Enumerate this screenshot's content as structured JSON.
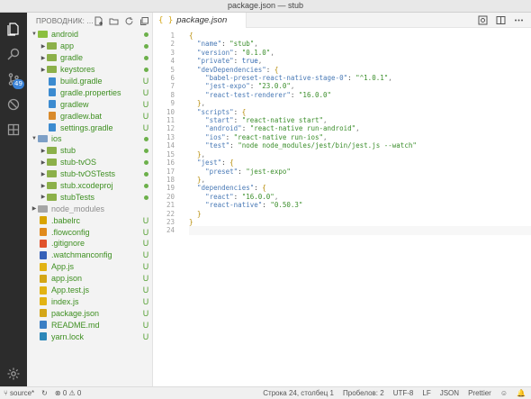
{
  "window": {
    "title": "package.json — stub"
  },
  "explorer": {
    "title": "ПРОВОДНИК: ...",
    "badge": "49",
    "items": [
      {
        "label": "android",
        "kind": "folder-open",
        "status": "dot"
      },
      {
        "label": "app",
        "kind": "folder",
        "status": "dot"
      },
      {
        "label": "gradle",
        "kind": "folder",
        "status": "dot"
      },
      {
        "label": "keystores",
        "kind": "folder",
        "status": "dot"
      },
      {
        "label": "build.gradle",
        "kind": "gradle",
        "status": "U"
      },
      {
        "label": "gradle.properties",
        "kind": "gradle",
        "status": "U"
      },
      {
        "label": "gradlew",
        "kind": "gradle",
        "status": "U"
      },
      {
        "label": "gradlew.bat",
        "kind": "bat",
        "status": "U"
      },
      {
        "label": "settings.gradle",
        "kind": "gradle",
        "status": "U"
      },
      {
        "label": "ios",
        "kind": "folder-open-ios",
        "status": "dot"
      },
      {
        "label": "stub",
        "kind": "folder",
        "status": "dot"
      },
      {
        "label": "stub-tvOS",
        "kind": "folder",
        "status": "dot"
      },
      {
        "label": "stub-tvOSTests",
        "kind": "folder",
        "status": "dot"
      },
      {
        "label": "stub.xcodeproj",
        "kind": "folder",
        "status": "dot"
      },
      {
        "label": "stubTests",
        "kind": "folder",
        "status": "dot"
      },
      {
        "label": "node_modules",
        "kind": "folder-grey",
        "status": ""
      },
      {
        "label": ".babelrc",
        "kind": "babel",
        "status": "U"
      },
      {
        "label": ".flowconfig",
        "kind": "flow",
        "status": "U"
      },
      {
        "label": ".gitignore",
        "kind": "git",
        "status": "U"
      },
      {
        "label": ".watchmanconfig",
        "kind": "watchman",
        "status": "U"
      },
      {
        "label": "App.js",
        "kind": "js",
        "status": "U"
      },
      {
        "label": "app.json",
        "kind": "json",
        "status": "U"
      },
      {
        "label": "App.test.js",
        "kind": "js",
        "status": "U"
      },
      {
        "label": "index.js",
        "kind": "js",
        "status": "U"
      },
      {
        "label": "package.json",
        "kind": "json",
        "status": "U"
      },
      {
        "label": "README.md",
        "kind": "md",
        "status": "U"
      },
      {
        "label": "yarn.lock",
        "kind": "yarn",
        "status": "U"
      }
    ]
  },
  "tab": {
    "label": "package.json",
    "icon": "{ }"
  },
  "editor": {
    "lines": [
      "{",
      "  \"name\": \"stub\",",
      "  \"version\": \"0.1.0\",",
      "  \"private\": true,",
      "  \"devDependencies\": {",
      "    \"babel-preset-react-native-stage-0\": \"^1.0.1\",",
      "    \"jest-expo\": \"23.0.0\",",
      "    \"react-test-renderer\": \"16.0.0\"",
      "  },",
      "  \"scripts\": {",
      "    \"start\": \"react-native start\",",
      "    \"android\": \"react-native run-android\",",
      "    \"ios\": \"react-native run-ios\",",
      "    \"test\": \"node node_modules/jest/bin/jest.js --watch\"",
      "  },",
      "  \"jest\": {",
      "    \"preset\": \"jest-expo\"",
      "  },",
      "  \"dependencies\": {",
      "    \"react\": \"16.0.0\",",
      "    \"react-native\": \"0.50.3\"",
      "  }",
      "}",
      ""
    ],
    "current_line": 24
  },
  "status": {
    "branch": "source*",
    "sync": "↻",
    "errors": "0",
    "warnings": "0",
    "position": "Строка 24, столбец 1",
    "spaces": "Пробелов: 2",
    "encoding": "UTF-8",
    "eol": "LF",
    "language": "JSON",
    "formatter": "Prettier"
  }
}
